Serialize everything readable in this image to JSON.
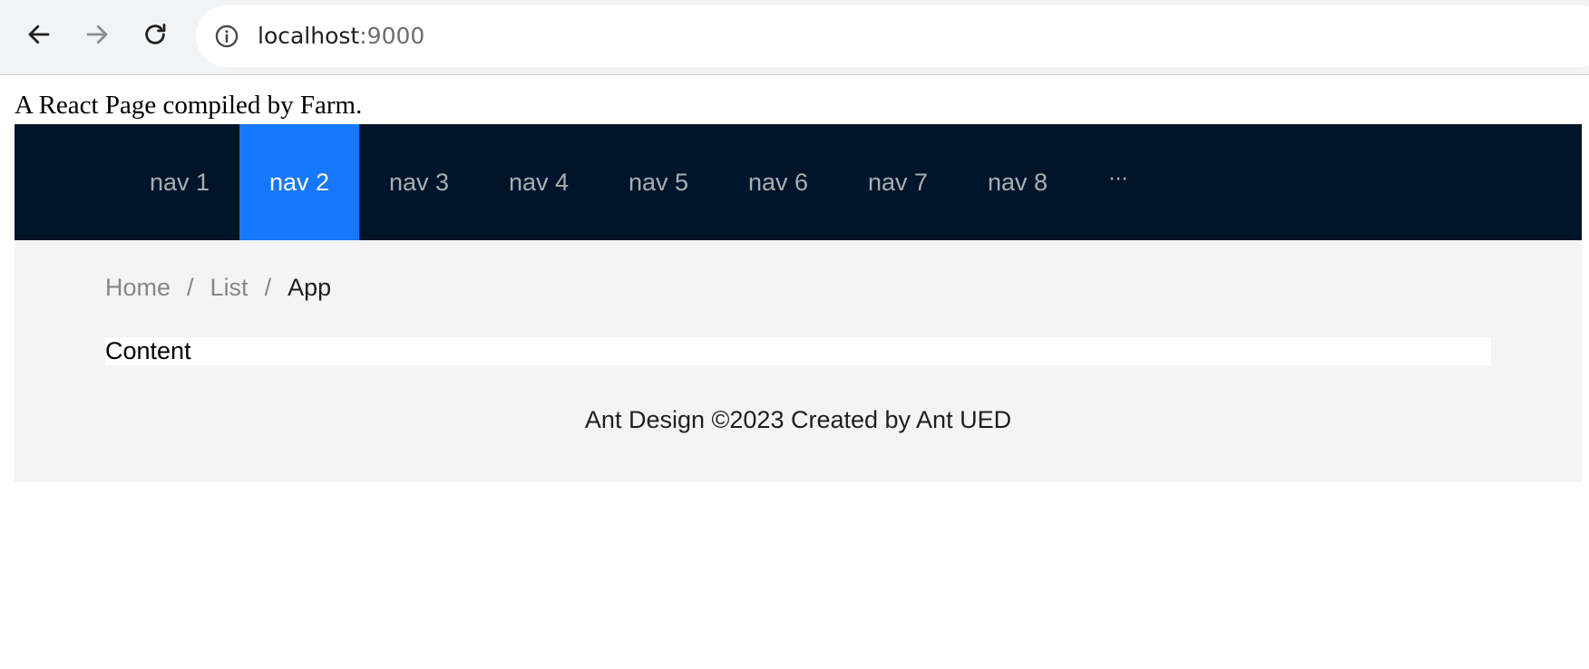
{
  "browser": {
    "url_host": "localhost",
    "url_port": ":9000",
    "icons": {
      "back": "arrow-left-icon",
      "forward": "arrow-right-icon",
      "reload": "reload-icon",
      "site_info": "info-icon"
    }
  },
  "page": {
    "heading": "A React Page compiled by Farm."
  },
  "header": {
    "menu": [
      {
        "label": "nav 1",
        "selected": false
      },
      {
        "label": "nav 2",
        "selected": true
      },
      {
        "label": "nav 3",
        "selected": false
      },
      {
        "label": "nav 4",
        "selected": false
      },
      {
        "label": "nav 5",
        "selected": false
      },
      {
        "label": "nav 6",
        "selected": false
      },
      {
        "label": "nav 7",
        "selected": false
      },
      {
        "label": "nav 8",
        "selected": false
      }
    ],
    "more_label": "···"
  },
  "breadcrumb": {
    "items": [
      "Home",
      "List",
      "App"
    ],
    "separator": "/"
  },
  "content": {
    "text": "Content"
  },
  "footer": {
    "text": "Ant Design ©2023 Created by Ant UED"
  },
  "colors": {
    "header_bg": "#001529",
    "selected_bg": "#1677ff",
    "layout_bg": "#f4f4f4"
  }
}
